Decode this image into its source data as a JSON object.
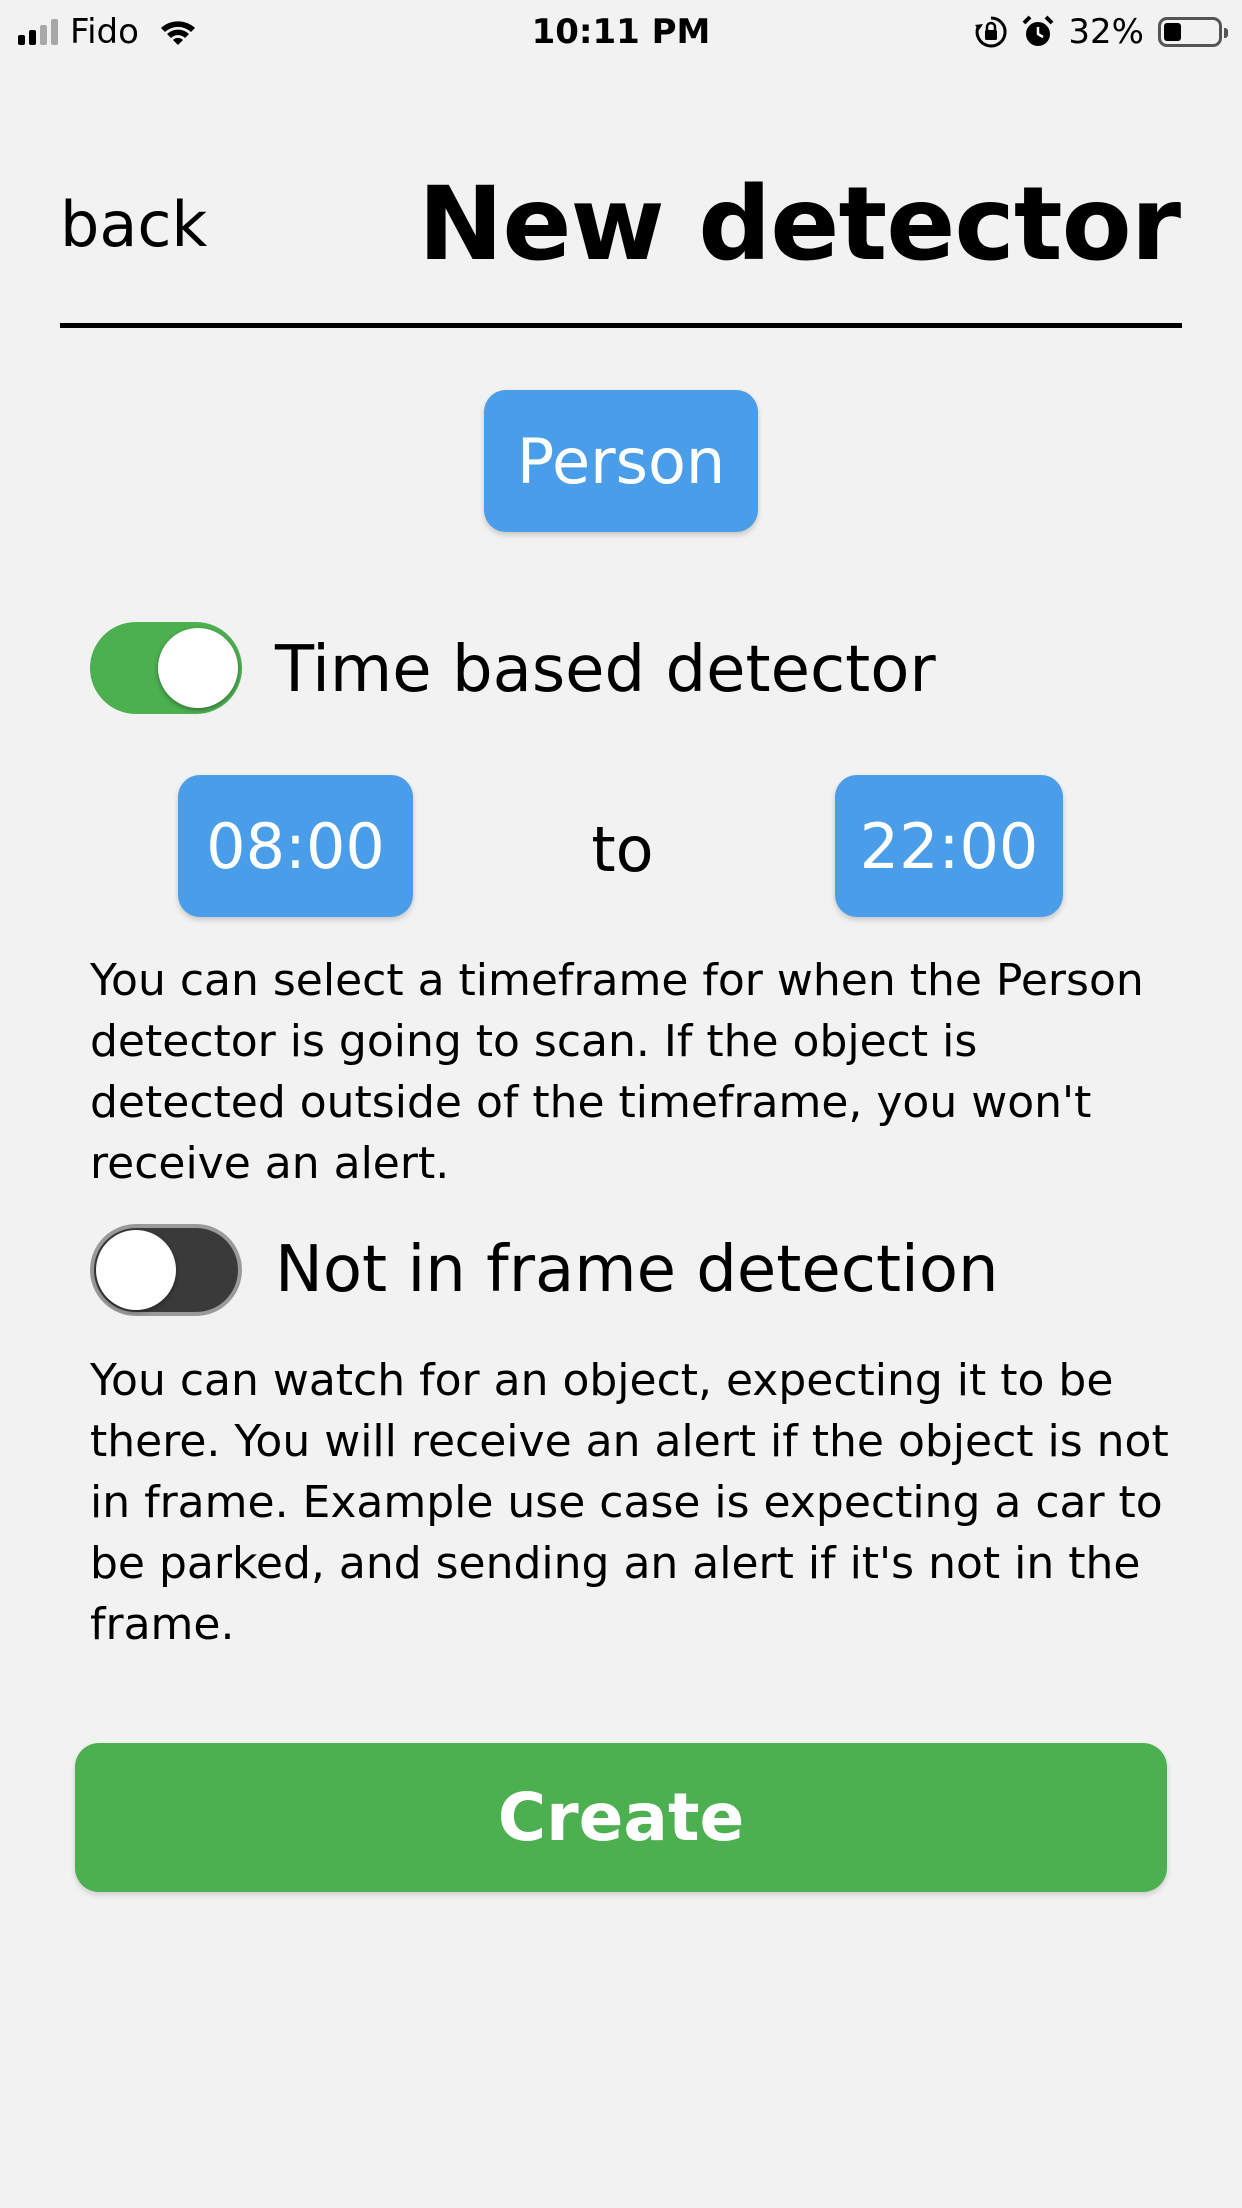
{
  "status_bar": {
    "carrier": "Fido",
    "time": "10:11 PM",
    "battery_percent": "32%",
    "signal_bars_filled": 2,
    "signal_bars_total": 4,
    "battery_level": 0.32,
    "icons": [
      "signal-icon",
      "wifi-icon",
      "rotation-lock-icon",
      "alarm-icon",
      "battery-icon"
    ]
  },
  "header": {
    "back_label": "back",
    "title": "New detector"
  },
  "object_button_label": "Person",
  "time_detector": {
    "label": "Time based detector",
    "enabled": true,
    "start_time": "08:00",
    "separator": "to",
    "end_time": "22:00",
    "description": "You can select a timeframe for when the Person detector is going to scan. If the object is detected outside of the timeframe, you won't receive an alert."
  },
  "frame_detection": {
    "label": "Not in frame detection",
    "enabled": false,
    "description": "You can watch for an object, expecting it to be there. You will receive an alert if the object is not in frame. Example use case is expecting a car to be parked, and sending an alert if it's not in the frame."
  },
  "create_label": "Create",
  "colors": {
    "background": "#f2f2f2",
    "button_blue": "#4a9de9",
    "accent_green": "#4caf50",
    "toggle_off": "#3a3a3a"
  }
}
